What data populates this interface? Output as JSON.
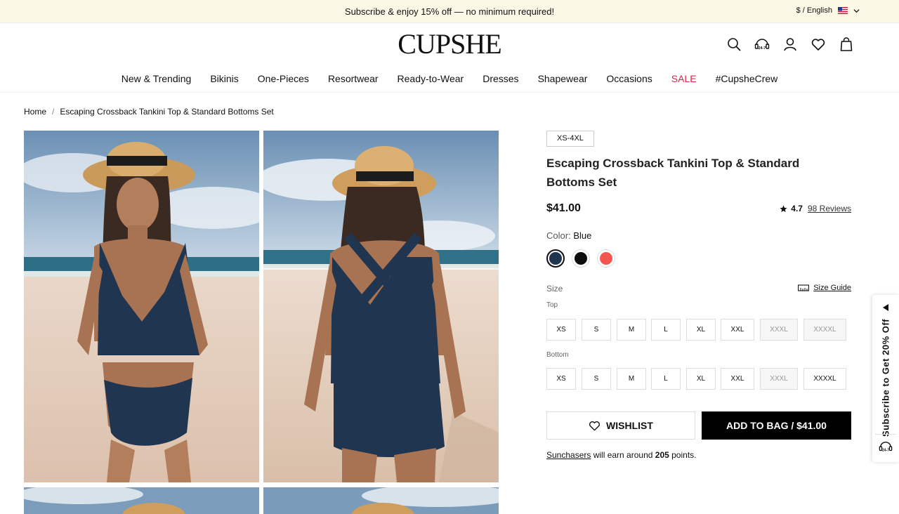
{
  "banner": {
    "text": "Subscribe & enjoy 15% off — no minimum required!",
    "locale": "$ / English"
  },
  "header": {
    "logo": "CUPSHE",
    "support_badge": "24-7",
    "icons": [
      "search-icon",
      "support-24-7-icon",
      "account-icon",
      "wishlist-heart-icon",
      "bag-icon"
    ]
  },
  "nav": {
    "items": [
      {
        "label": "New & Trending"
      },
      {
        "label": "Bikinis"
      },
      {
        "label": "One-Pieces"
      },
      {
        "label": "Resortwear"
      },
      {
        "label": "Ready-to-Wear"
      },
      {
        "label": "Dresses"
      },
      {
        "label": "Shapewear"
      },
      {
        "label": "Occasions"
      },
      {
        "label": "SALE"
      },
      {
        "label": "#CupsheCrew"
      }
    ],
    "sale_color": "#e0244a"
  },
  "breadcrumb": {
    "home": "Home",
    "separator": "/",
    "current": "Escaping Crossback Tankini Top & Standard Bottoms Set"
  },
  "product": {
    "size_range_badge": "XS-4XL",
    "title": "Escaping Crossback Tankini Top & Standard Bottoms Set",
    "price": "$41.00",
    "rating": "4.7",
    "reviews": "98 Reviews",
    "color_label": "Color:",
    "color_value": "Blue",
    "swatches": [
      {
        "name": "Blue",
        "hex": "#1f3550",
        "selected": true
      },
      {
        "name": "Black",
        "hex": "#0d0d0d",
        "selected": false
      },
      {
        "name": "Coral",
        "hex": "#f4564f",
        "selected": false
      }
    ],
    "size_label": "Size",
    "size_guide": "Size Guide",
    "top_label": "Top",
    "bottom_label": "Bottom",
    "top_sizes": [
      {
        "label": "XS",
        "available": true
      },
      {
        "label": "S",
        "available": true
      },
      {
        "label": "M",
        "available": true
      },
      {
        "label": "L",
        "available": true
      },
      {
        "label": "XL",
        "available": true
      },
      {
        "label": "XXL",
        "available": true
      },
      {
        "label": "XXXL",
        "available": false
      },
      {
        "label": "XXXXL",
        "available": false
      }
    ],
    "bottom_sizes": [
      {
        "label": "XS",
        "available": true
      },
      {
        "label": "S",
        "available": true
      },
      {
        "label": "M",
        "available": true
      },
      {
        "label": "L",
        "available": true
      },
      {
        "label": "XL",
        "available": true
      },
      {
        "label": "XXL",
        "available": true
      },
      {
        "label": "XXXL",
        "available": false
      },
      {
        "label": "XXXXL",
        "available": true
      }
    ],
    "wishlist_label": "WISHLIST",
    "add_to_bag_label": "ADD TO BAG / $41.00",
    "points_link": "Sunchasers",
    "points_mid": " will earn around ",
    "points_value": "205",
    "points_end": " points."
  },
  "side_tab": {
    "text": "Subscribe to Get 20% Off"
  }
}
